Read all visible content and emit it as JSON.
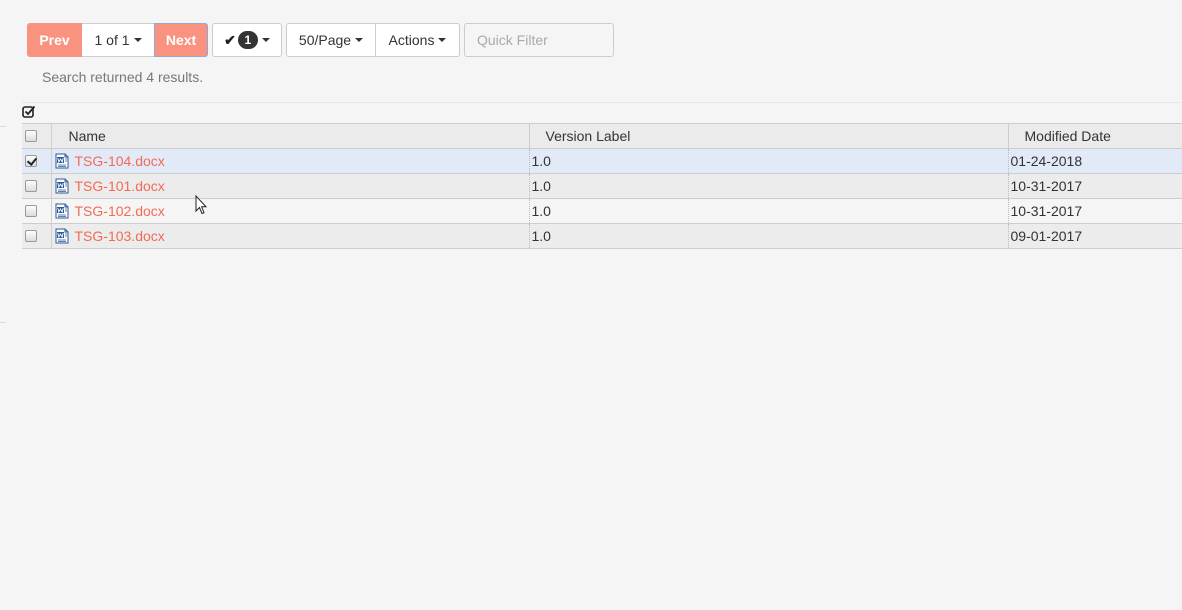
{
  "pager": {
    "prev_label": "Prev",
    "page_label": "1 of 1",
    "next_label": "Next",
    "selected_count": "1",
    "per_page_label": "50/Page",
    "actions_label": "Actions"
  },
  "filter": {
    "placeholder": "Quick Filter",
    "value": ""
  },
  "result_text": "Search returned 4 results.",
  "columns": {
    "name": "Name",
    "version": "Version Label",
    "modified": "Modified Date"
  },
  "rows": [
    {
      "name": "TSG-104.docx",
      "version": "1.0",
      "modified": "01-24-2018",
      "checked": true,
      "icon": "word-doc-icon"
    },
    {
      "name": "TSG-101.docx",
      "version": "1.0",
      "modified": "10-31-2017",
      "checked": false,
      "icon": "word-doc-icon"
    },
    {
      "name": "TSG-102.docx",
      "version": "1.0",
      "modified": "10-31-2017",
      "checked": false,
      "icon": "word-doc-icon"
    },
    {
      "name": "TSG-103.docx",
      "version": "1.0",
      "modified": "09-01-2017",
      "checked": false,
      "icon": "word-doc-icon"
    }
  ],
  "colors": {
    "accent": "#f9937f",
    "link": "#f26b55",
    "selected_row": "#e2eaf8",
    "background": "#f5f5f5"
  }
}
